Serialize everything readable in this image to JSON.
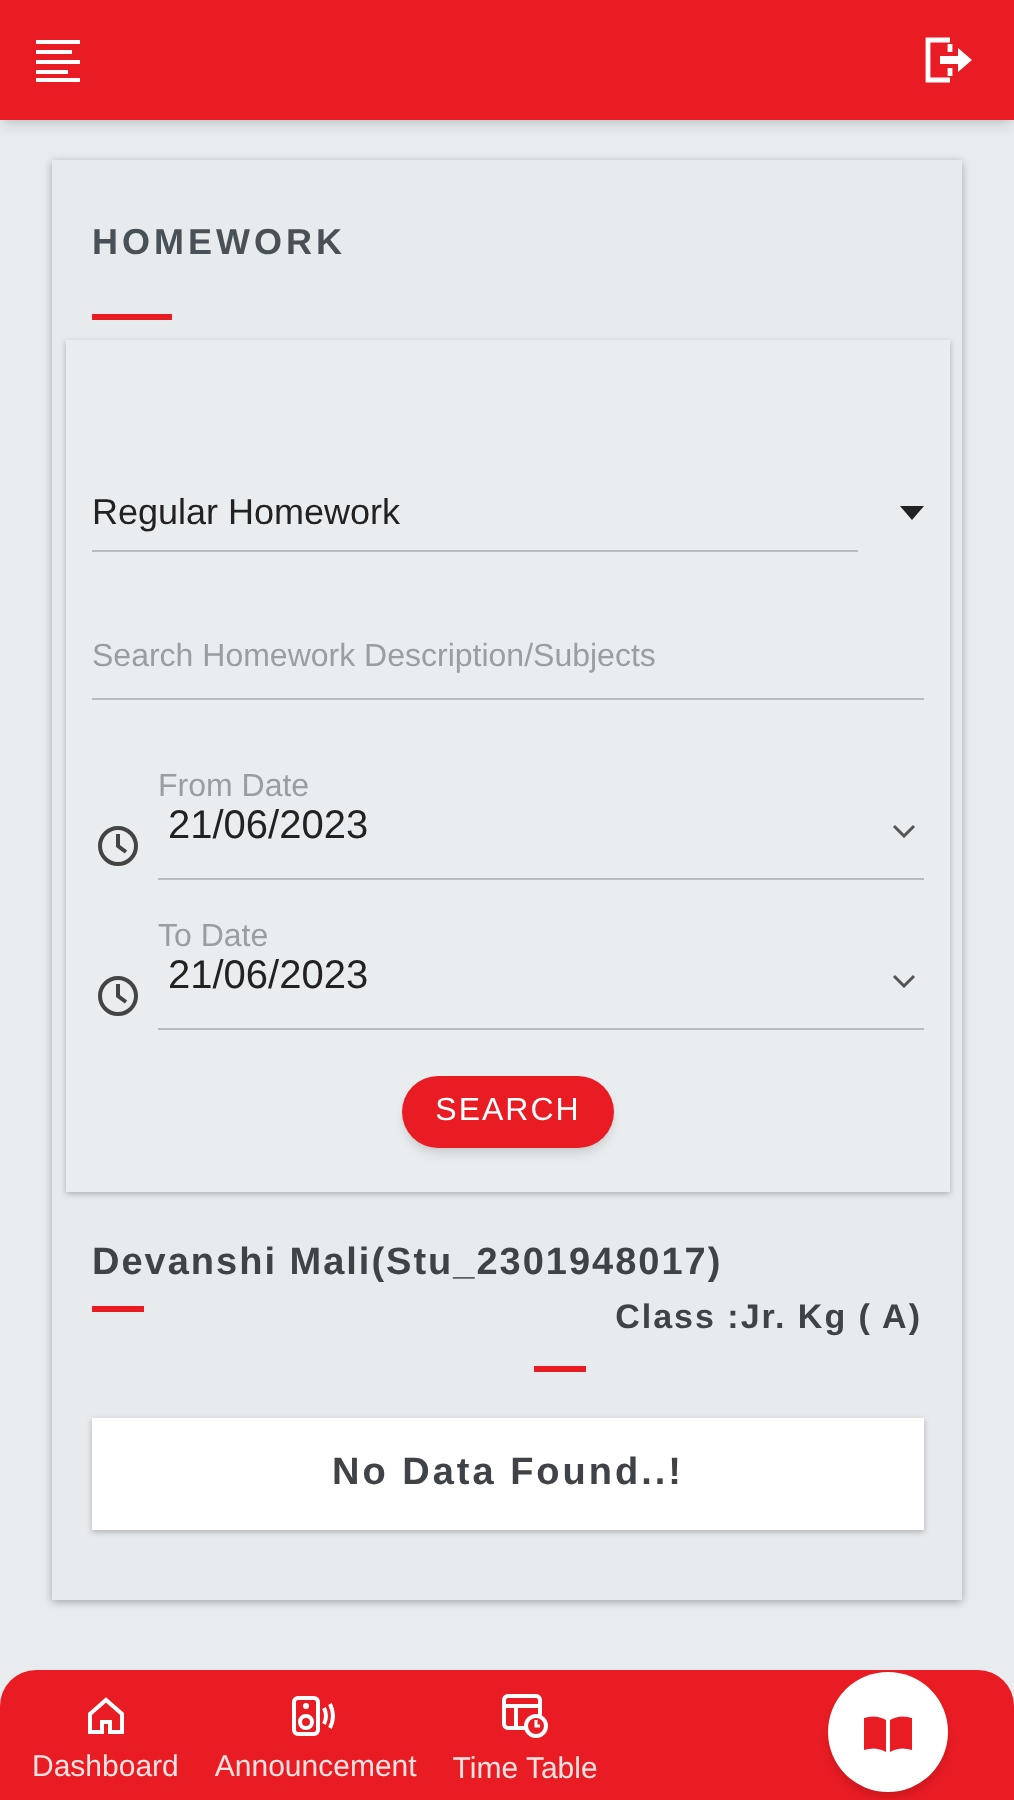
{
  "page_title": "HOMEWORK",
  "filter": {
    "homework_type": "Regular Homework",
    "search": {
      "placeholder": "Search Homework Description/Subjects"
    },
    "dates": [
      {
        "label": "From Date",
        "value": "21/06/2023"
      },
      {
        "label": "To Date",
        "value": "21/06/2023"
      }
    ],
    "button": "SEARCH"
  },
  "student": {
    "name": "Devanshi Mali(Stu_2301948017)",
    "class": "Class :Jr. Kg ( A)"
  },
  "result": "No Data Found..!",
  "nav": [
    {
      "label": "Dashboard",
      "selected": false
    },
    {
      "label": "Announcement",
      "selected": false
    },
    {
      "label": "Time Table",
      "selected": false
    },
    {
      "selected": true
    }
  ]
}
